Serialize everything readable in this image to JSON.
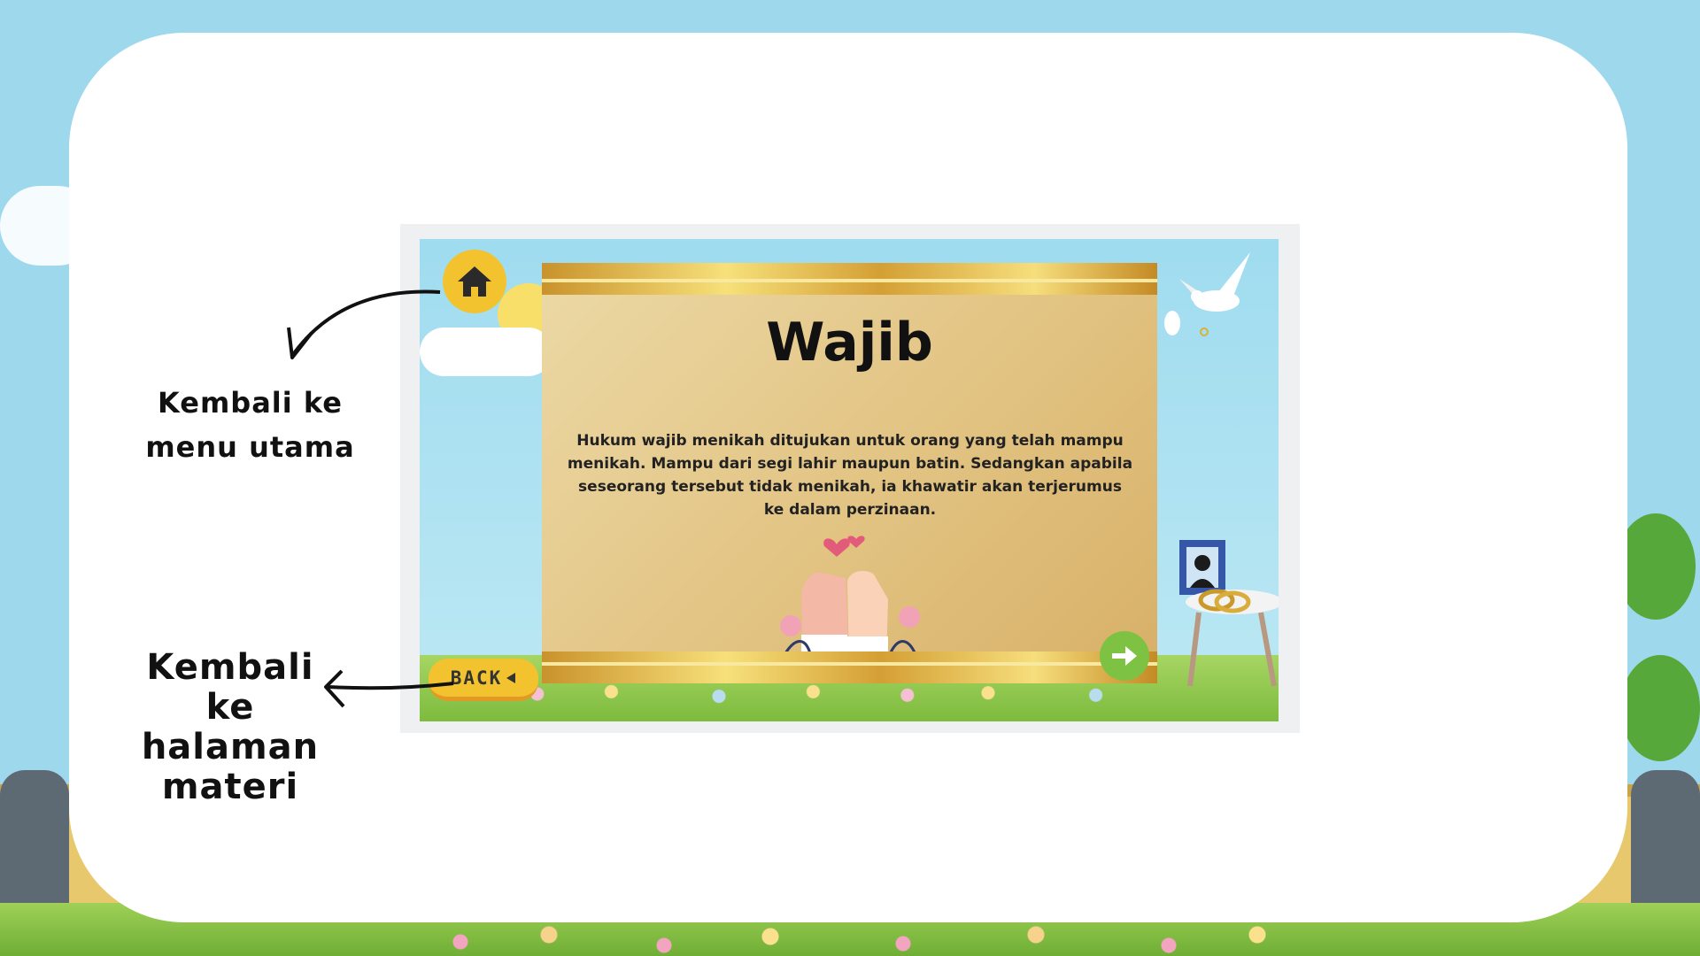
{
  "slide": {
    "title": "Wajib",
    "body": "Hukum wajib menikah ditujukan untuk orang yang telah mampu menikah. Mampu dari segi lahir maupun batin. Sedangkan apabila seseorang tersebut tidak menikah, ia khawatir akan terjerumus ke dalam perzinaan.",
    "back_label": "BACK",
    "home_icon": "home-icon",
    "next_icon": "arrow-right-icon"
  },
  "annotations": {
    "home_caption": "Kembali ke menu utama",
    "back_caption": "Kembali ke halaman materi"
  },
  "colors": {
    "sky": "#9ed8ec",
    "card": "#ffffff",
    "button_yellow": "#f3c22f",
    "next_green": "#7ec243",
    "panel_gold": "#e2c382"
  }
}
